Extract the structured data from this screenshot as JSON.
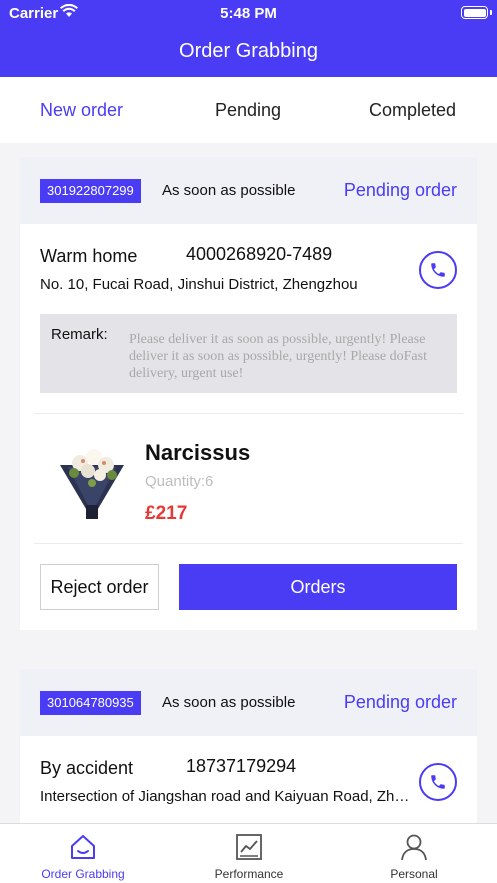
{
  "status_bar": {
    "carrier": "Carrier",
    "time": "5:48 PM"
  },
  "header": {
    "title": "Order Grabbing"
  },
  "tabs": [
    {
      "label": "New order",
      "active": true
    },
    {
      "label": "Pending",
      "active": false
    },
    {
      "label": "Completed",
      "active": false
    }
  ],
  "orders": [
    {
      "order_no": "301922807299",
      "delivery_time": "As soon as possible",
      "status": "Pending order",
      "customer_name": "Warm home",
      "phone": "4000268920-7489",
      "address": "No. 10, Fucai Road, Jinshui District, Zhengzhou",
      "remark_label": "Remark:",
      "remark_text": "Please deliver it as soon as possible, urgently! Please deliver it as soon as possible, urgently! Please doFast delivery, urgent use!",
      "product_name": "Narcissus",
      "quantity": "Quantity:6",
      "price": "£217",
      "reject_label": "Reject order",
      "accept_label": "Orders"
    },
    {
      "order_no": "301064780935",
      "delivery_time": "As soon as possible",
      "status": "Pending order",
      "customer_name": "By accident",
      "phone": "18737179294",
      "address": "Intersection of Jiangshan road and Kaiyuan Road, Zhengzhou"
    }
  ],
  "bottom_nav": [
    {
      "label": "Order Grabbing",
      "icon": "home-icon",
      "active": true
    },
    {
      "label": "Performance",
      "icon": "chart-icon",
      "active": false
    },
    {
      "label": "Personal",
      "icon": "person-icon",
      "active": false
    }
  ],
  "colors": {
    "accent": "#4a3bf5",
    "price": "#e53935"
  }
}
